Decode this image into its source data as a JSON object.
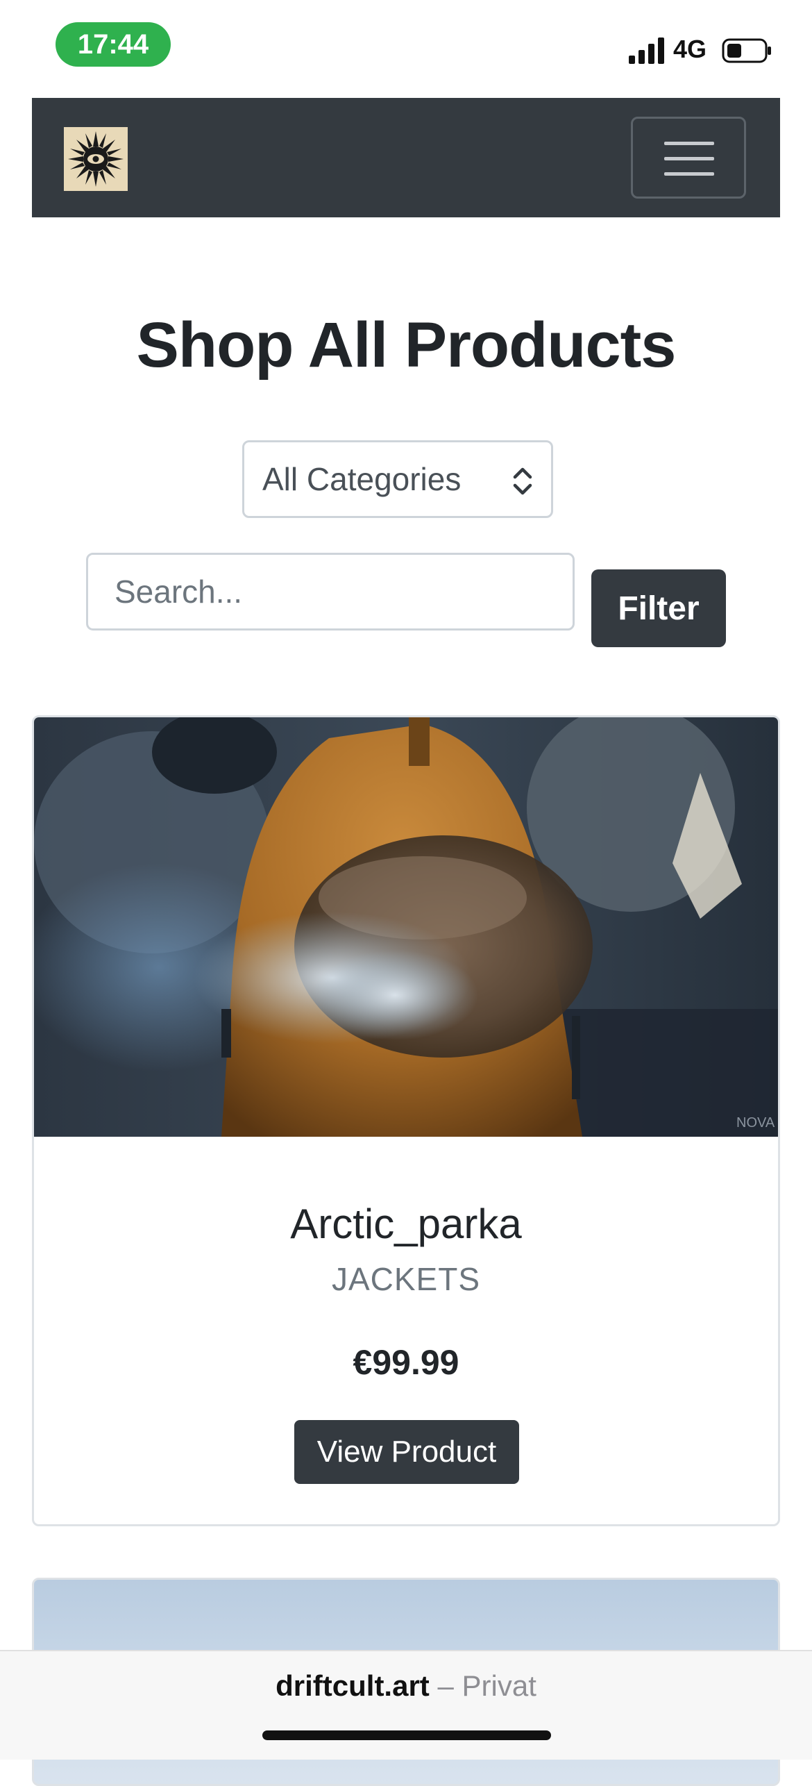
{
  "status_bar": {
    "time": "17:44",
    "network": "4G"
  },
  "navbar": {
    "logo_icon": "sun-eye-logo-icon",
    "menu_icon": "hamburger-menu-icon"
  },
  "main": {
    "title": "Shop All Products",
    "category_select": {
      "selected": "All Categories"
    },
    "search": {
      "placeholder": "Search..."
    },
    "filter_label": "Filter"
  },
  "products": [
    {
      "name": "Arctic_parka",
      "category": "JACKETS",
      "price": "€99.99",
      "button_label": "View Product",
      "watermark": "NOVA"
    }
  ],
  "browser": {
    "domain": "driftcult.art",
    "separator": " – ",
    "mode": "Privat"
  },
  "colors": {
    "navbar": "#343a40",
    "time_pill": "#2fb14e",
    "button": "#343a40",
    "muted": "#6c757d"
  }
}
